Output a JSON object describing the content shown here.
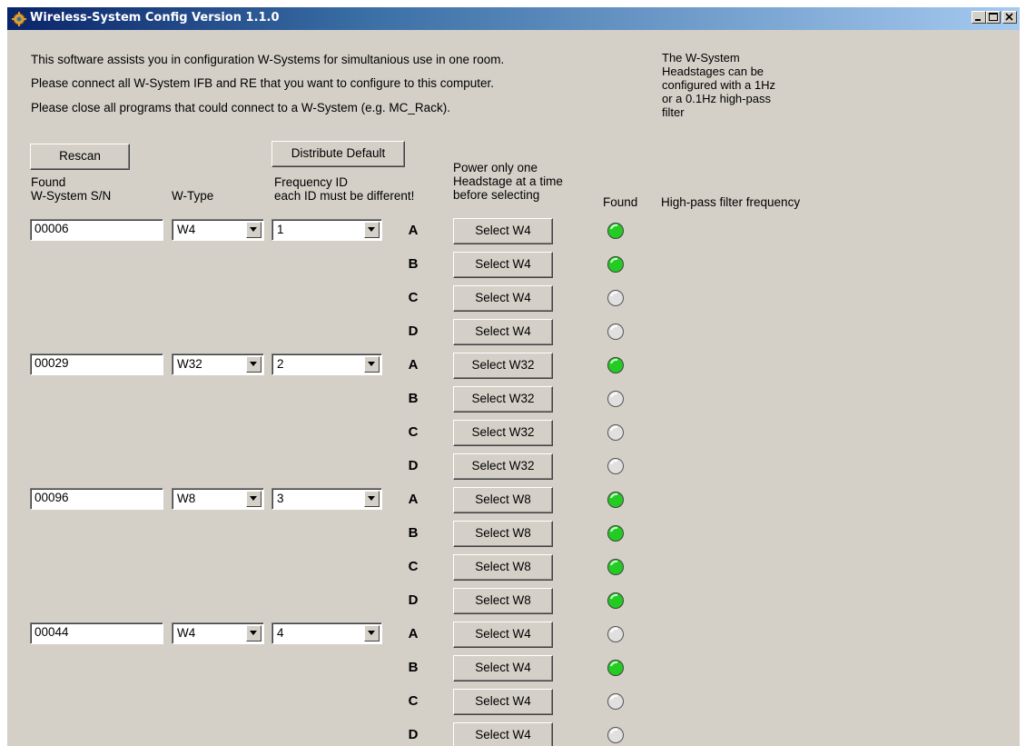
{
  "window": {
    "title": "Wireless-System Config Version 1.1.0"
  },
  "info_lines": [
    "This software assists you in configuration W-Systems for simultanious use in one room.",
    "Please connect all W-System IFB and RE that you want to configure to this computer.",
    "Please close all programs that could connect to a W-System (e.g. MC_Rack)."
  ],
  "side_note": [
    "The W-System",
    "Headstages can be",
    "configured with a 1Hz",
    "or a 0.1Hz high-pass",
    "filter"
  ],
  "buttons": {
    "rescan": "Rescan",
    "distribute": "Distribute Default"
  },
  "headers": {
    "found_sn": [
      "Found",
      "W-System S/N"
    ],
    "wtype": "W-Type",
    "freq": [
      "Frequency ID",
      "each ID must be different!"
    ],
    "power": [
      "Power only one",
      "Headstage at a time",
      "before selecting"
    ],
    "found": "Found",
    "highpass": "High-pass filter frequency"
  },
  "colors": {
    "found_led": "#22cc22",
    "off_led": "#e0e0e0",
    "window_bg": "#d4d0c8"
  },
  "systems": [
    {
      "sn": "00006",
      "wtype": "W4",
      "freq": "1",
      "headstages": [
        {
          "letter": "A",
          "button": "Select W4",
          "found": true
        },
        {
          "letter": "B",
          "button": "Select W4",
          "found": true
        },
        {
          "letter": "C",
          "button": "Select W4",
          "found": false
        },
        {
          "letter": "D",
          "button": "Select W4",
          "found": false
        }
      ]
    },
    {
      "sn": "00029",
      "wtype": "W32",
      "freq": "2",
      "headstages": [
        {
          "letter": "A",
          "button": "Select W32",
          "found": true
        },
        {
          "letter": "B",
          "button": "Select W32",
          "found": false
        },
        {
          "letter": "C",
          "button": "Select W32",
          "found": false
        },
        {
          "letter": "D",
          "button": "Select W32",
          "found": false
        }
      ]
    },
    {
      "sn": "00096",
      "wtype": "W8",
      "freq": "3",
      "headstages": [
        {
          "letter": "A",
          "button": "Select W8",
          "found": true
        },
        {
          "letter": "B",
          "button": "Select W8",
          "found": true
        },
        {
          "letter": "C",
          "button": "Select W8",
          "found": true
        },
        {
          "letter": "D",
          "button": "Select W8",
          "found": true
        }
      ]
    },
    {
      "sn": "00044",
      "wtype": "W4",
      "freq": "4",
      "headstages": [
        {
          "letter": "A",
          "button": "Select W4",
          "found": false
        },
        {
          "letter": "B",
          "button": "Select W4",
          "found": true
        },
        {
          "letter": "C",
          "button": "Select W4",
          "found": false
        },
        {
          "letter": "D",
          "button": "Select W4",
          "found": false
        }
      ]
    }
  ]
}
